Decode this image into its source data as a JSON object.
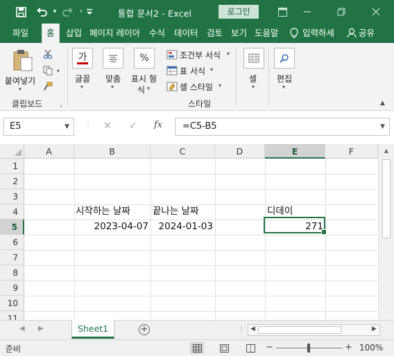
{
  "titlebar": {
    "title": "통합 문서2  -  Excel",
    "login": "로그인",
    "icons": [
      "save-icon",
      "undo-icon",
      "redo-icon",
      "customize-icon",
      "ribbon-display-icon",
      "minimize-icon",
      "restore-icon",
      "close-icon"
    ]
  },
  "tabs": [
    "파일",
    "홈",
    "삽입",
    "페이지 레이아",
    "수식",
    "데이터",
    "검토",
    "보기",
    "도움말",
    "입력하세",
    "공유"
  ],
  "active_tab": "홈",
  "ribbon": {
    "paste_label": "붙여넣기",
    "clipboard_label": "클립보드",
    "font_label": "글꼴",
    "font_icon": "가",
    "align_label": "맞춤",
    "number_label_1": "표시 형",
    "number_label_2": "식",
    "number_icon": "%",
    "cond_format": "조건부 서식",
    "table_format": "표 서식",
    "cell_style": "셀 스타일",
    "styles_label": "스타일",
    "cells_label": "셀",
    "edit_label": "편집"
  },
  "formula_bar": {
    "name_box": "E5",
    "formula": "=C5-B5",
    "fx": "fx"
  },
  "grid": {
    "columns": [
      "A",
      "B",
      "C",
      "D",
      "E",
      "F"
    ],
    "rows": [
      "1",
      "2",
      "3",
      "4",
      "5",
      "6",
      "7",
      "8",
      "9",
      "10",
      "11"
    ],
    "selected_cell": "E5",
    "cells": {
      "B4": "시작하는 날짜",
      "C4": "끝나는 날짜",
      "E4": "디데이",
      "B5": "2023-04-07",
      "C5": "2024-01-03",
      "E5": "271"
    }
  },
  "sheets": {
    "active": "Sheet1"
  },
  "status": {
    "ready": "준비",
    "zoom": "100%"
  },
  "colors": {
    "accent": "#217346"
  }
}
